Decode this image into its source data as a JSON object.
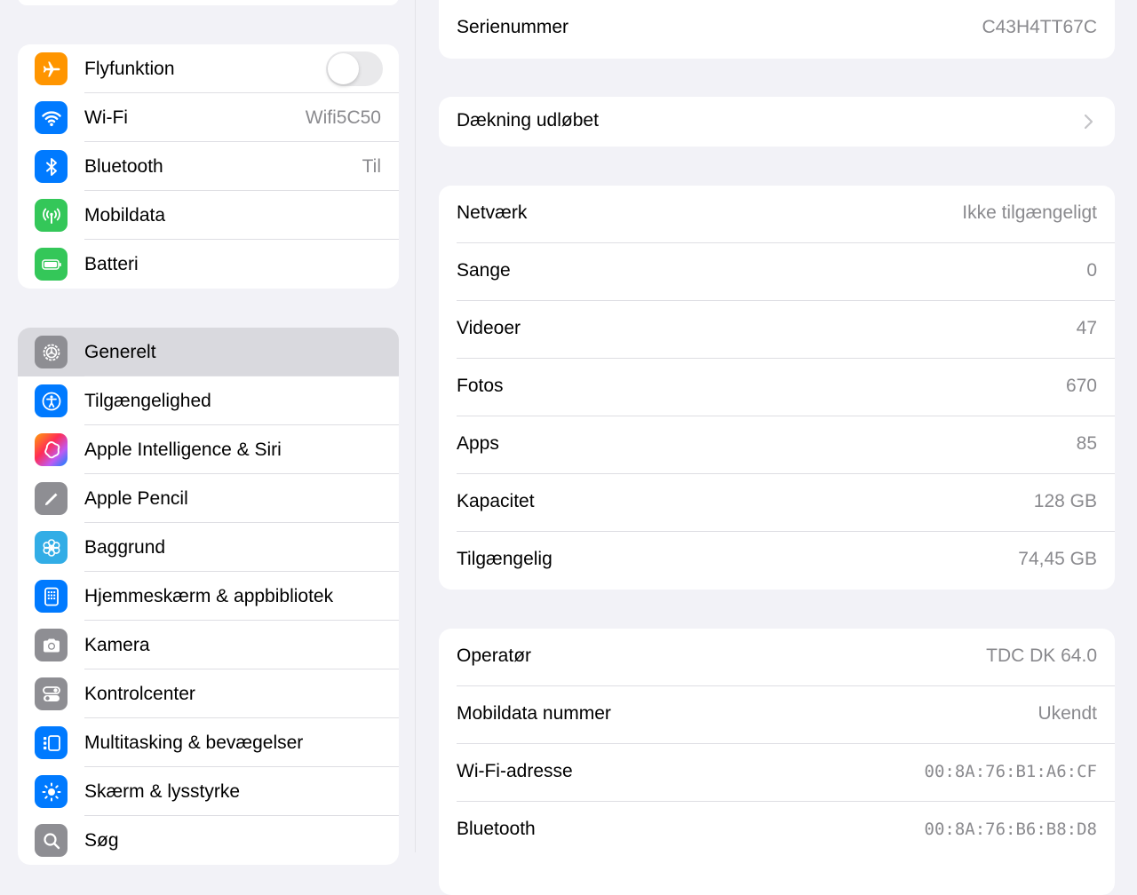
{
  "sidebar": {
    "connectivity": [
      {
        "label": "Flyfunktion",
        "icon": "airplane-icon",
        "color": "#ff9500",
        "toggle": false
      },
      {
        "label": "Wi-Fi",
        "value": "Wifi5C50",
        "icon": "wifi-icon",
        "color": "#007aff"
      },
      {
        "label": "Bluetooth",
        "value": "Til",
        "icon": "bluetooth-icon",
        "color": "#007aff"
      },
      {
        "label": "Mobildata",
        "icon": "antenna-icon",
        "color": "#34c759"
      },
      {
        "label": "Batteri",
        "icon": "battery-icon",
        "color": "#34c759"
      }
    ],
    "general": [
      {
        "label": "Generelt",
        "icon": "gear-icon",
        "color": "#8e8e93",
        "selected": true
      },
      {
        "label": "Tilgængelighed",
        "icon": "accessibility-icon",
        "color": "#007aff"
      },
      {
        "label": "Apple Intelligence & Siri",
        "icon": "apple-intelligence-icon",
        "color": "#c86dd7"
      },
      {
        "label": "Apple Pencil",
        "icon": "pencil-icon",
        "color": "#8e8e93"
      },
      {
        "label": "Baggrund",
        "icon": "flower-icon",
        "color": "#32ade6"
      },
      {
        "label": "Hjemmeskærm & appbibliotek",
        "icon": "home-screen-icon",
        "color": "#007aff"
      },
      {
        "label": "Kamera",
        "icon": "camera-icon",
        "color": "#8e8e93"
      },
      {
        "label": "Kontrolcenter",
        "icon": "switches-icon",
        "color": "#8e8e93"
      },
      {
        "label": "Multitasking & bevægelser",
        "icon": "multitasking-icon",
        "color": "#007aff"
      },
      {
        "label": "Skærm & lysstyrke",
        "icon": "sun-icon",
        "color": "#007aff"
      },
      {
        "label": "Søg",
        "icon": "search-icon",
        "color": "#8e8e93"
      }
    ]
  },
  "detail": {
    "serial": {
      "label": "Serienummer",
      "value": "C43H4TT67C"
    },
    "coverage": {
      "label": "Dækning udløbet"
    },
    "stats": [
      {
        "label": "Netværk",
        "value": "Ikke tilgængeligt"
      },
      {
        "label": "Sange",
        "value": "0"
      },
      {
        "label": "Videoer",
        "value": "47"
      },
      {
        "label": "Fotos",
        "value": "670"
      },
      {
        "label": "Apps",
        "value": "85"
      },
      {
        "label": "Kapacitet",
        "value": "128 GB"
      },
      {
        "label": "Tilgængelig",
        "value": "74,45 GB"
      }
    ],
    "network": [
      {
        "label": "Operatør",
        "value": "TDC DK 64.0",
        "mono": false
      },
      {
        "label": "Mobildata nummer",
        "value": "Ukendt",
        "mono": false
      },
      {
        "label": "Wi-Fi-adresse",
        "value": "00:8A:76:B1:A6:CF",
        "mono": true
      },
      {
        "label": "Bluetooth",
        "value": "00:8A:76:B6:B8:D8",
        "mono": true
      }
    ]
  }
}
